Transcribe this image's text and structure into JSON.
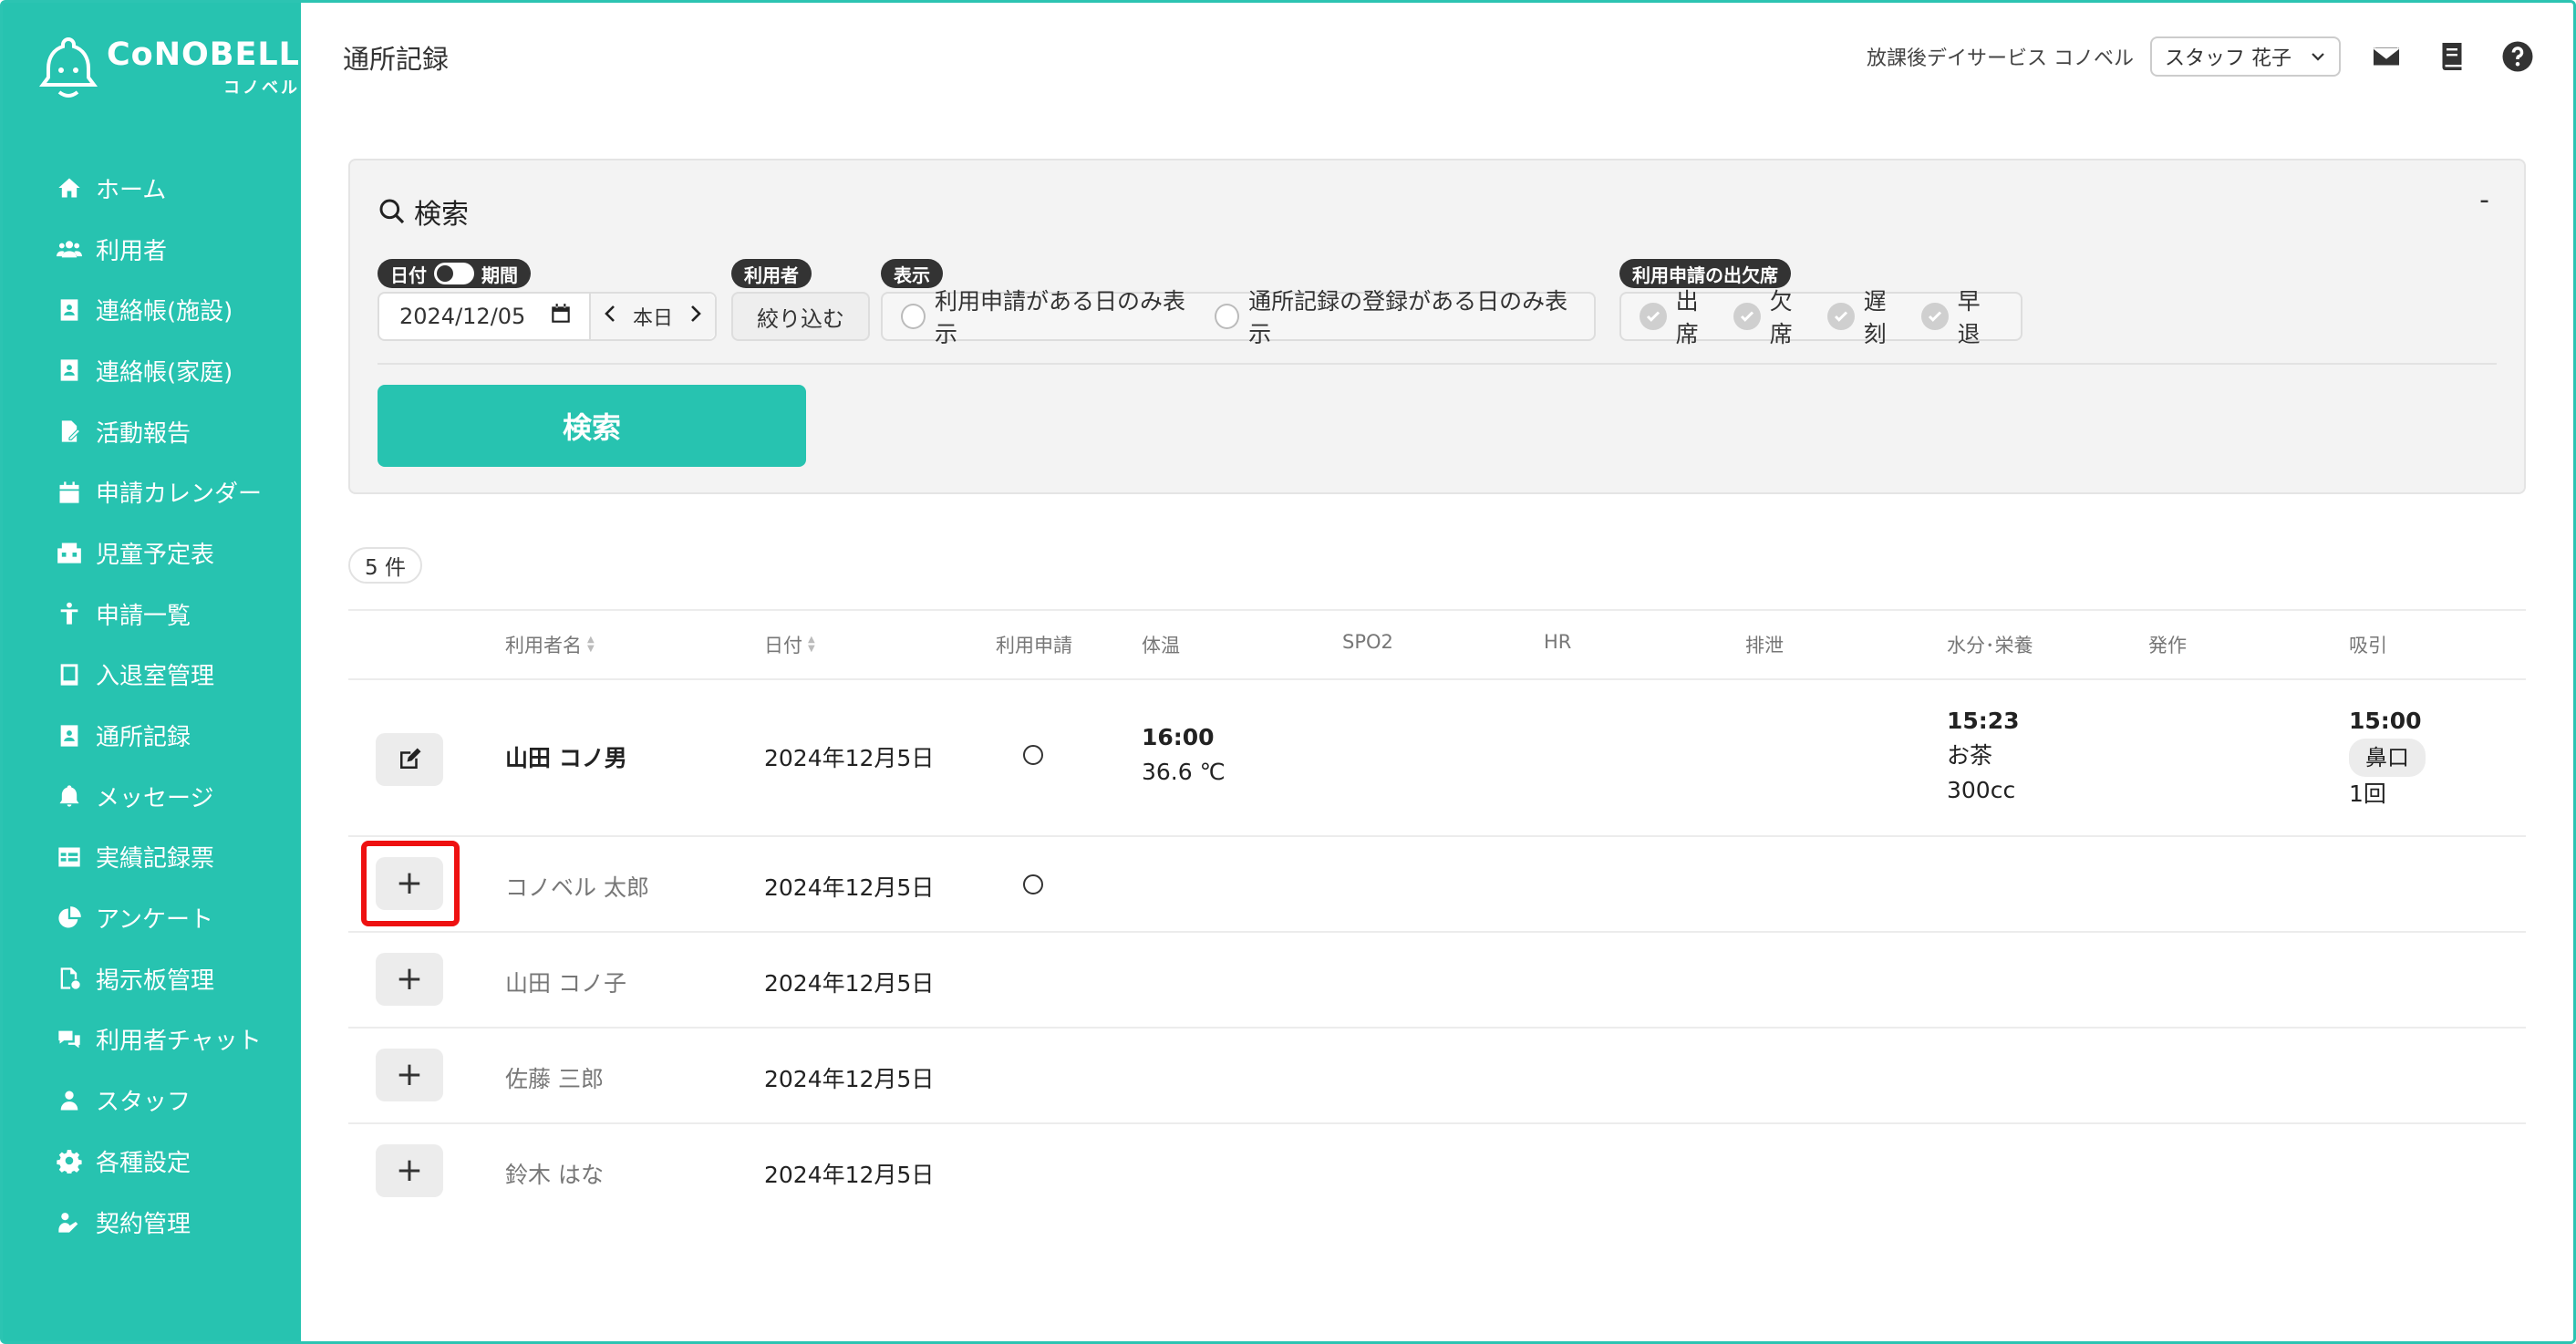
{
  "brand": {
    "name": "CoNOBELL",
    "sub": "コノベル",
    "color": "#27c3b0"
  },
  "sidebar": {
    "items": [
      {
        "label": "ホーム",
        "icon": "home-icon"
      },
      {
        "label": "利用者",
        "icon": "users-icon"
      },
      {
        "label": "連絡帳(施設)",
        "icon": "contact-book-icon"
      },
      {
        "label": "連絡帳(家庭)",
        "icon": "contact-book-icon"
      },
      {
        "label": "活動報告",
        "icon": "report-icon"
      },
      {
        "label": "申請カレンダー",
        "icon": "calendar-icon"
      },
      {
        "label": "児童予定表",
        "icon": "schedule-icon"
      },
      {
        "label": "申請一覧",
        "icon": "child-icon"
      },
      {
        "label": "入退室管理",
        "icon": "tablet-icon"
      },
      {
        "label": "通所記録",
        "icon": "record-icon"
      },
      {
        "label": "メッセージ",
        "icon": "bell-icon"
      },
      {
        "label": "実績記録票",
        "icon": "table-icon"
      },
      {
        "label": "アンケート",
        "icon": "pie-chart-icon"
      },
      {
        "label": "掲示板管理",
        "icon": "bulletin-icon"
      },
      {
        "label": "利用者チャット",
        "icon": "chat-icon"
      },
      {
        "label": "スタッフ",
        "icon": "staff-icon"
      },
      {
        "label": "各種設定",
        "icon": "gear-icon"
      },
      {
        "label": "契約管理",
        "icon": "contract-icon"
      }
    ]
  },
  "header": {
    "title": "通所記録",
    "facility": "放課後デイサービス コノベル",
    "staff": "スタッフ 花子"
  },
  "search": {
    "title": "検索",
    "collapse": "-",
    "date_label_left": "日付",
    "date_label_right": "期間",
    "date_value": "2024/12/05",
    "today": "本日",
    "user_label": "利用者",
    "narrow": "絞り込む",
    "display_label": "表示",
    "display_options": [
      "利用申請がある日のみ表示",
      "通所記録の登録がある日のみ表示"
    ],
    "attendance_label": "利用申請の出欠席",
    "attendance_options": [
      "出席",
      "欠席",
      "遅刻",
      "早退"
    ],
    "button": "検索"
  },
  "count": "5 件",
  "table": {
    "headers": [
      "利用者名",
      "日付",
      "利用申請",
      "体温",
      "SPO2",
      "HR",
      "排泄",
      "水分･栄養",
      "発作",
      "吸引"
    ],
    "rows": [
      {
        "name": "山田 コノ男",
        "date": "2024年12月5日",
        "applied": true,
        "action": "edit",
        "temp_time": "16:00",
        "temp_value": "36.6 ℃",
        "water_time": "15:23",
        "water_item": "お茶",
        "water_amount": "300cc",
        "suction_time": "15:00",
        "suction_type": "鼻口",
        "suction_count": "1回"
      },
      {
        "name": "コノベル 太郎",
        "date": "2024年12月5日",
        "applied": true,
        "action": "add",
        "highlighted": true
      },
      {
        "name": "山田 コノ子",
        "date": "2024年12月5日",
        "applied": false,
        "action": "add"
      },
      {
        "name": "佐藤 三郎",
        "date": "2024年12月5日",
        "applied": false,
        "action": "add"
      },
      {
        "name": "鈴木 はな",
        "date": "2024年12月5日",
        "applied": false,
        "action": "add"
      }
    ]
  }
}
